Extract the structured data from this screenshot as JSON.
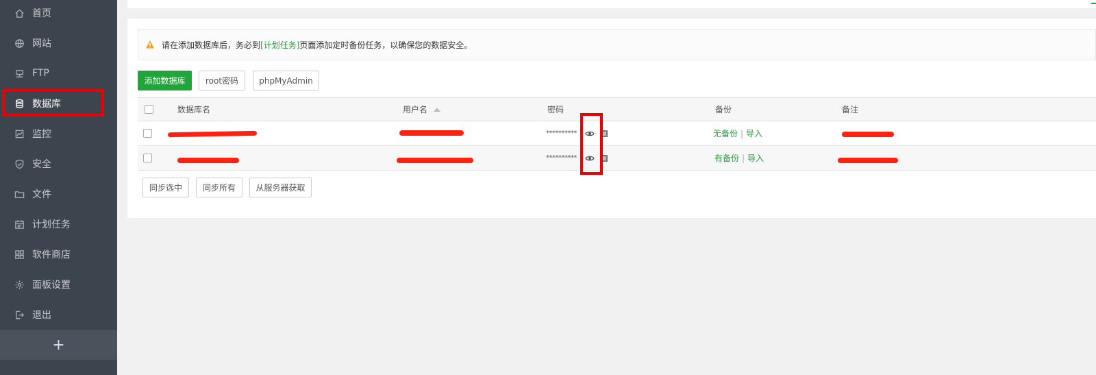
{
  "sidebar": {
    "items": [
      {
        "label": "首页",
        "icon": "home-icon"
      },
      {
        "label": "网站",
        "icon": "globe-icon"
      },
      {
        "label": "FTP",
        "icon": "ftp-icon"
      },
      {
        "label": "数据库",
        "icon": "database-icon",
        "active": true
      },
      {
        "label": "监控",
        "icon": "monitor-icon"
      },
      {
        "label": "安全",
        "icon": "shield-icon"
      },
      {
        "label": "文件",
        "icon": "folder-icon"
      },
      {
        "label": "计划任务",
        "icon": "calendar-icon"
      },
      {
        "label": "软件商店",
        "icon": "grid-icon"
      },
      {
        "label": "面板设置",
        "icon": "gear-icon"
      },
      {
        "label": "退出",
        "icon": "logout-icon"
      }
    ],
    "add_label": "+"
  },
  "alert": {
    "prefix": "请在添加数据库后，务必到",
    "link": "[计划任务]",
    "suffix": "页面添加定时备份任务，以确保您的数据安全。"
  },
  "toolbar": {
    "add_db": "添加数据库",
    "root_password": "root密码",
    "phpmyadmin": "phpMyAdmin"
  },
  "table": {
    "headers": {
      "name": "数据库名",
      "user": "用户名",
      "password": "密码",
      "backup": "备份",
      "note": "备注"
    },
    "rows": [
      {
        "password": "**********",
        "backup": "无备份",
        "import": "导入"
      },
      {
        "password": "**********",
        "backup": "有备份",
        "import": "导入"
      }
    ]
  },
  "footer_buttons": {
    "sync_selected": "同步选中",
    "sync_all": "同步所有",
    "fetch_from_server": "从服务器获取"
  },
  "colors": {
    "sidebar_bg": "#3c444d",
    "accent_green": "#20a53a",
    "highlight_red": "#ee0000"
  }
}
